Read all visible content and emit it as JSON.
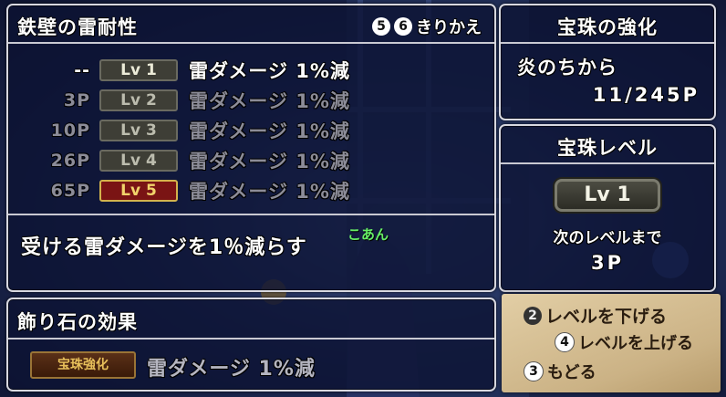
{
  "skill_panel": {
    "title": "鉄壁の雷耐性",
    "switch_btn_a": "5",
    "switch_btn_b": "6",
    "switch_label": "きりかえ",
    "levels": [
      {
        "cost": "--",
        "level": "Lv 1",
        "effect": "雷ダメージ 1%減",
        "state": "current"
      },
      {
        "cost": "3P",
        "level": "Lv 2",
        "effect": "雷ダメージ 1%減",
        "state": "locked"
      },
      {
        "cost": "10P",
        "level": "Lv 3",
        "effect": "雷ダメージ 1%減",
        "state": "locked"
      },
      {
        "cost": "26P",
        "level": "Lv 4",
        "effect": "雷ダメージ 1%減",
        "state": "locked"
      },
      {
        "cost": "65P",
        "level": "Lv 5",
        "effect": "雷ダメージ 1%減",
        "state": "selected"
      }
    ],
    "description": "受ける雷ダメージを1％減らす",
    "player_name": "こあん"
  },
  "orb_panel": {
    "title": "宝珠の強化",
    "source": "炎のちから",
    "points": "11/245P"
  },
  "orb_level_panel": {
    "title": "宝珠レベル",
    "level": "Lv 1",
    "next_label": "次のレベルまで",
    "next_points": "3P"
  },
  "ornament_panel": {
    "title": "飾り石の効果",
    "tag": "宝珠強化",
    "effect": "雷ダメージ 1%減"
  },
  "controls": {
    "down_btn": "2",
    "down_label": "レベルを下げる",
    "up_btn": "4",
    "up_label": "レベルを上げる",
    "back_btn": "3",
    "back_label": "もどる"
  },
  "colors": {
    "panel_bg": "#0c1232",
    "panel_border": "#d8d8e0",
    "selected_level_bg": "#7a1414",
    "selected_level_text": "#f2d36a",
    "parchment": "#d8c39a",
    "ornament_text": "#e7bf5a"
  }
}
